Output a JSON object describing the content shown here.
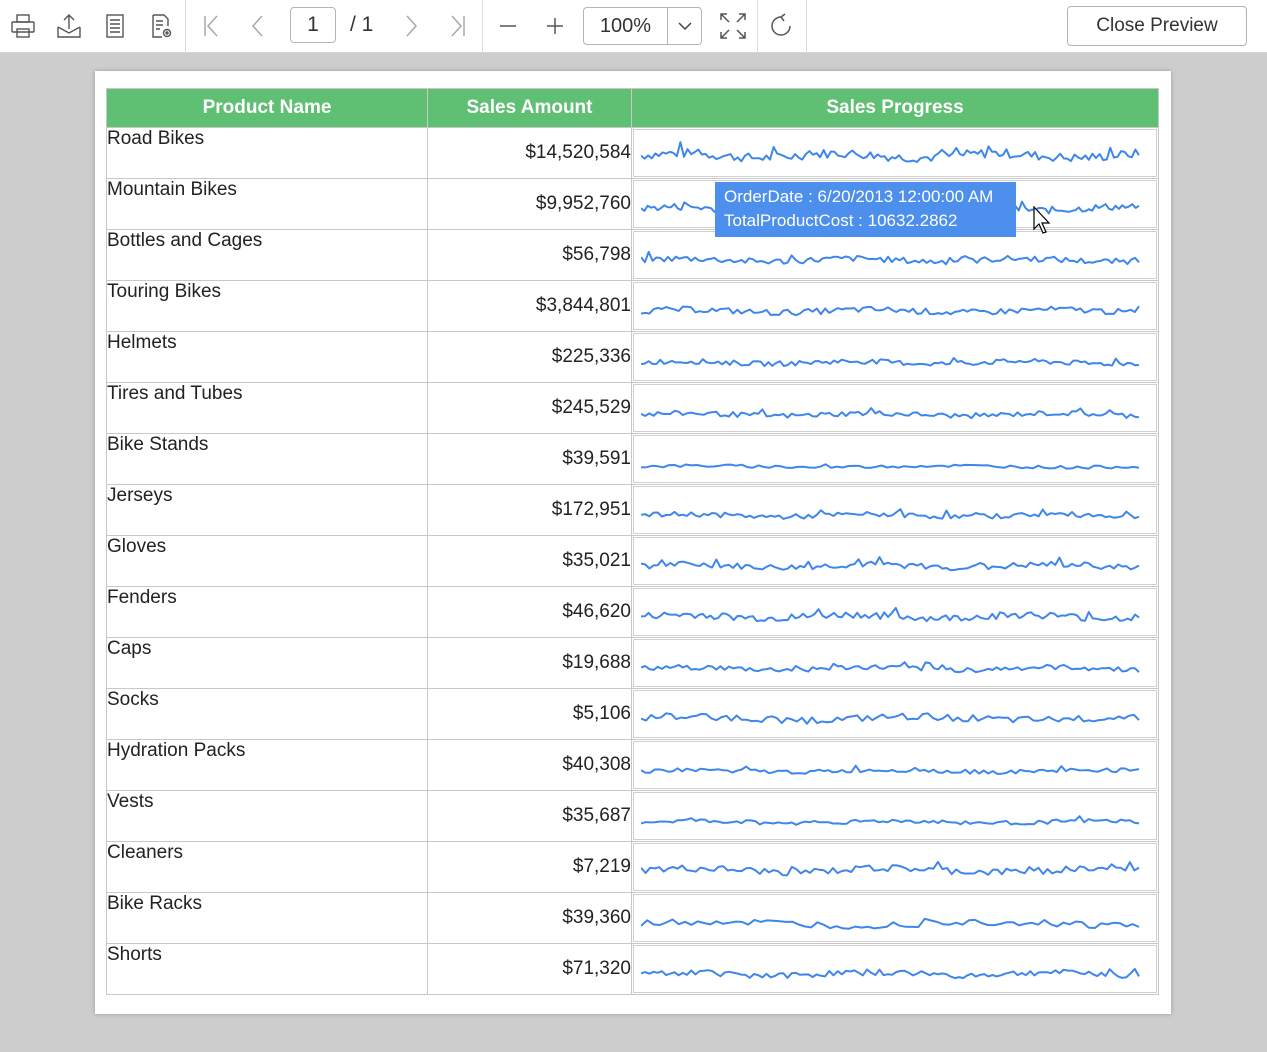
{
  "toolbar": {
    "current_page": "1",
    "page_total": "/ 1",
    "zoom": "100%",
    "close_label": "Close Preview"
  },
  "table": {
    "headers": [
      "Product Name",
      "Sales Amount",
      "Sales Progress"
    ],
    "rows": [
      {
        "name": "Road Bikes",
        "amount": "$14,520,584"
      },
      {
        "name": "Mountain Bikes",
        "amount": "$9,952,760"
      },
      {
        "name": "Bottles and Cages",
        "amount": "$56,798"
      },
      {
        "name": "Touring Bikes",
        "amount": "$3,844,801"
      },
      {
        "name": "Helmets",
        "amount": "$225,336"
      },
      {
        "name": "Tires and Tubes",
        "amount": "$245,529"
      },
      {
        "name": "Bike Stands",
        "amount": "$39,591"
      },
      {
        "name": "Jerseys",
        "amount": "$172,951"
      },
      {
        "name": "Gloves",
        "amount": "$35,021"
      },
      {
        "name": "Fenders",
        "amount": "$46,620"
      },
      {
        "name": "Caps",
        "amount": "$19,688"
      },
      {
        "name": "Socks",
        "amount": "$5,106"
      },
      {
        "name": "Hydration Packs",
        "amount": "$40,308"
      },
      {
        "name": "Vests",
        "amount": "$35,687"
      },
      {
        "name": "Cleaners",
        "amount": "$7,219"
      },
      {
        "name": "Bike Racks",
        "amount": "$39,360"
      },
      {
        "name": "Shorts",
        "amount": "$71,320"
      }
    ]
  },
  "tooltip": {
    "line1": "OrderDate : 6/20/2013 12:00:00 AM",
    "line2": "TotalProductCost : 10632.2862"
  },
  "colors": {
    "header_green": "#5fbf73",
    "sparkline_blue": "#3f86ea",
    "tooltip_blue": "#4c8fec"
  },
  "icons": [
    "print-icon",
    "export-icon",
    "page-setup-icon",
    "page-settings-icon",
    "first-page-icon",
    "previous-page-icon",
    "next-page-icon",
    "last-page-icon",
    "zoom-out-icon",
    "zoom-in-icon",
    "zoom-dropdown-icon",
    "fit-page-icon",
    "refresh-icon",
    "cursor-icon"
  ]
}
